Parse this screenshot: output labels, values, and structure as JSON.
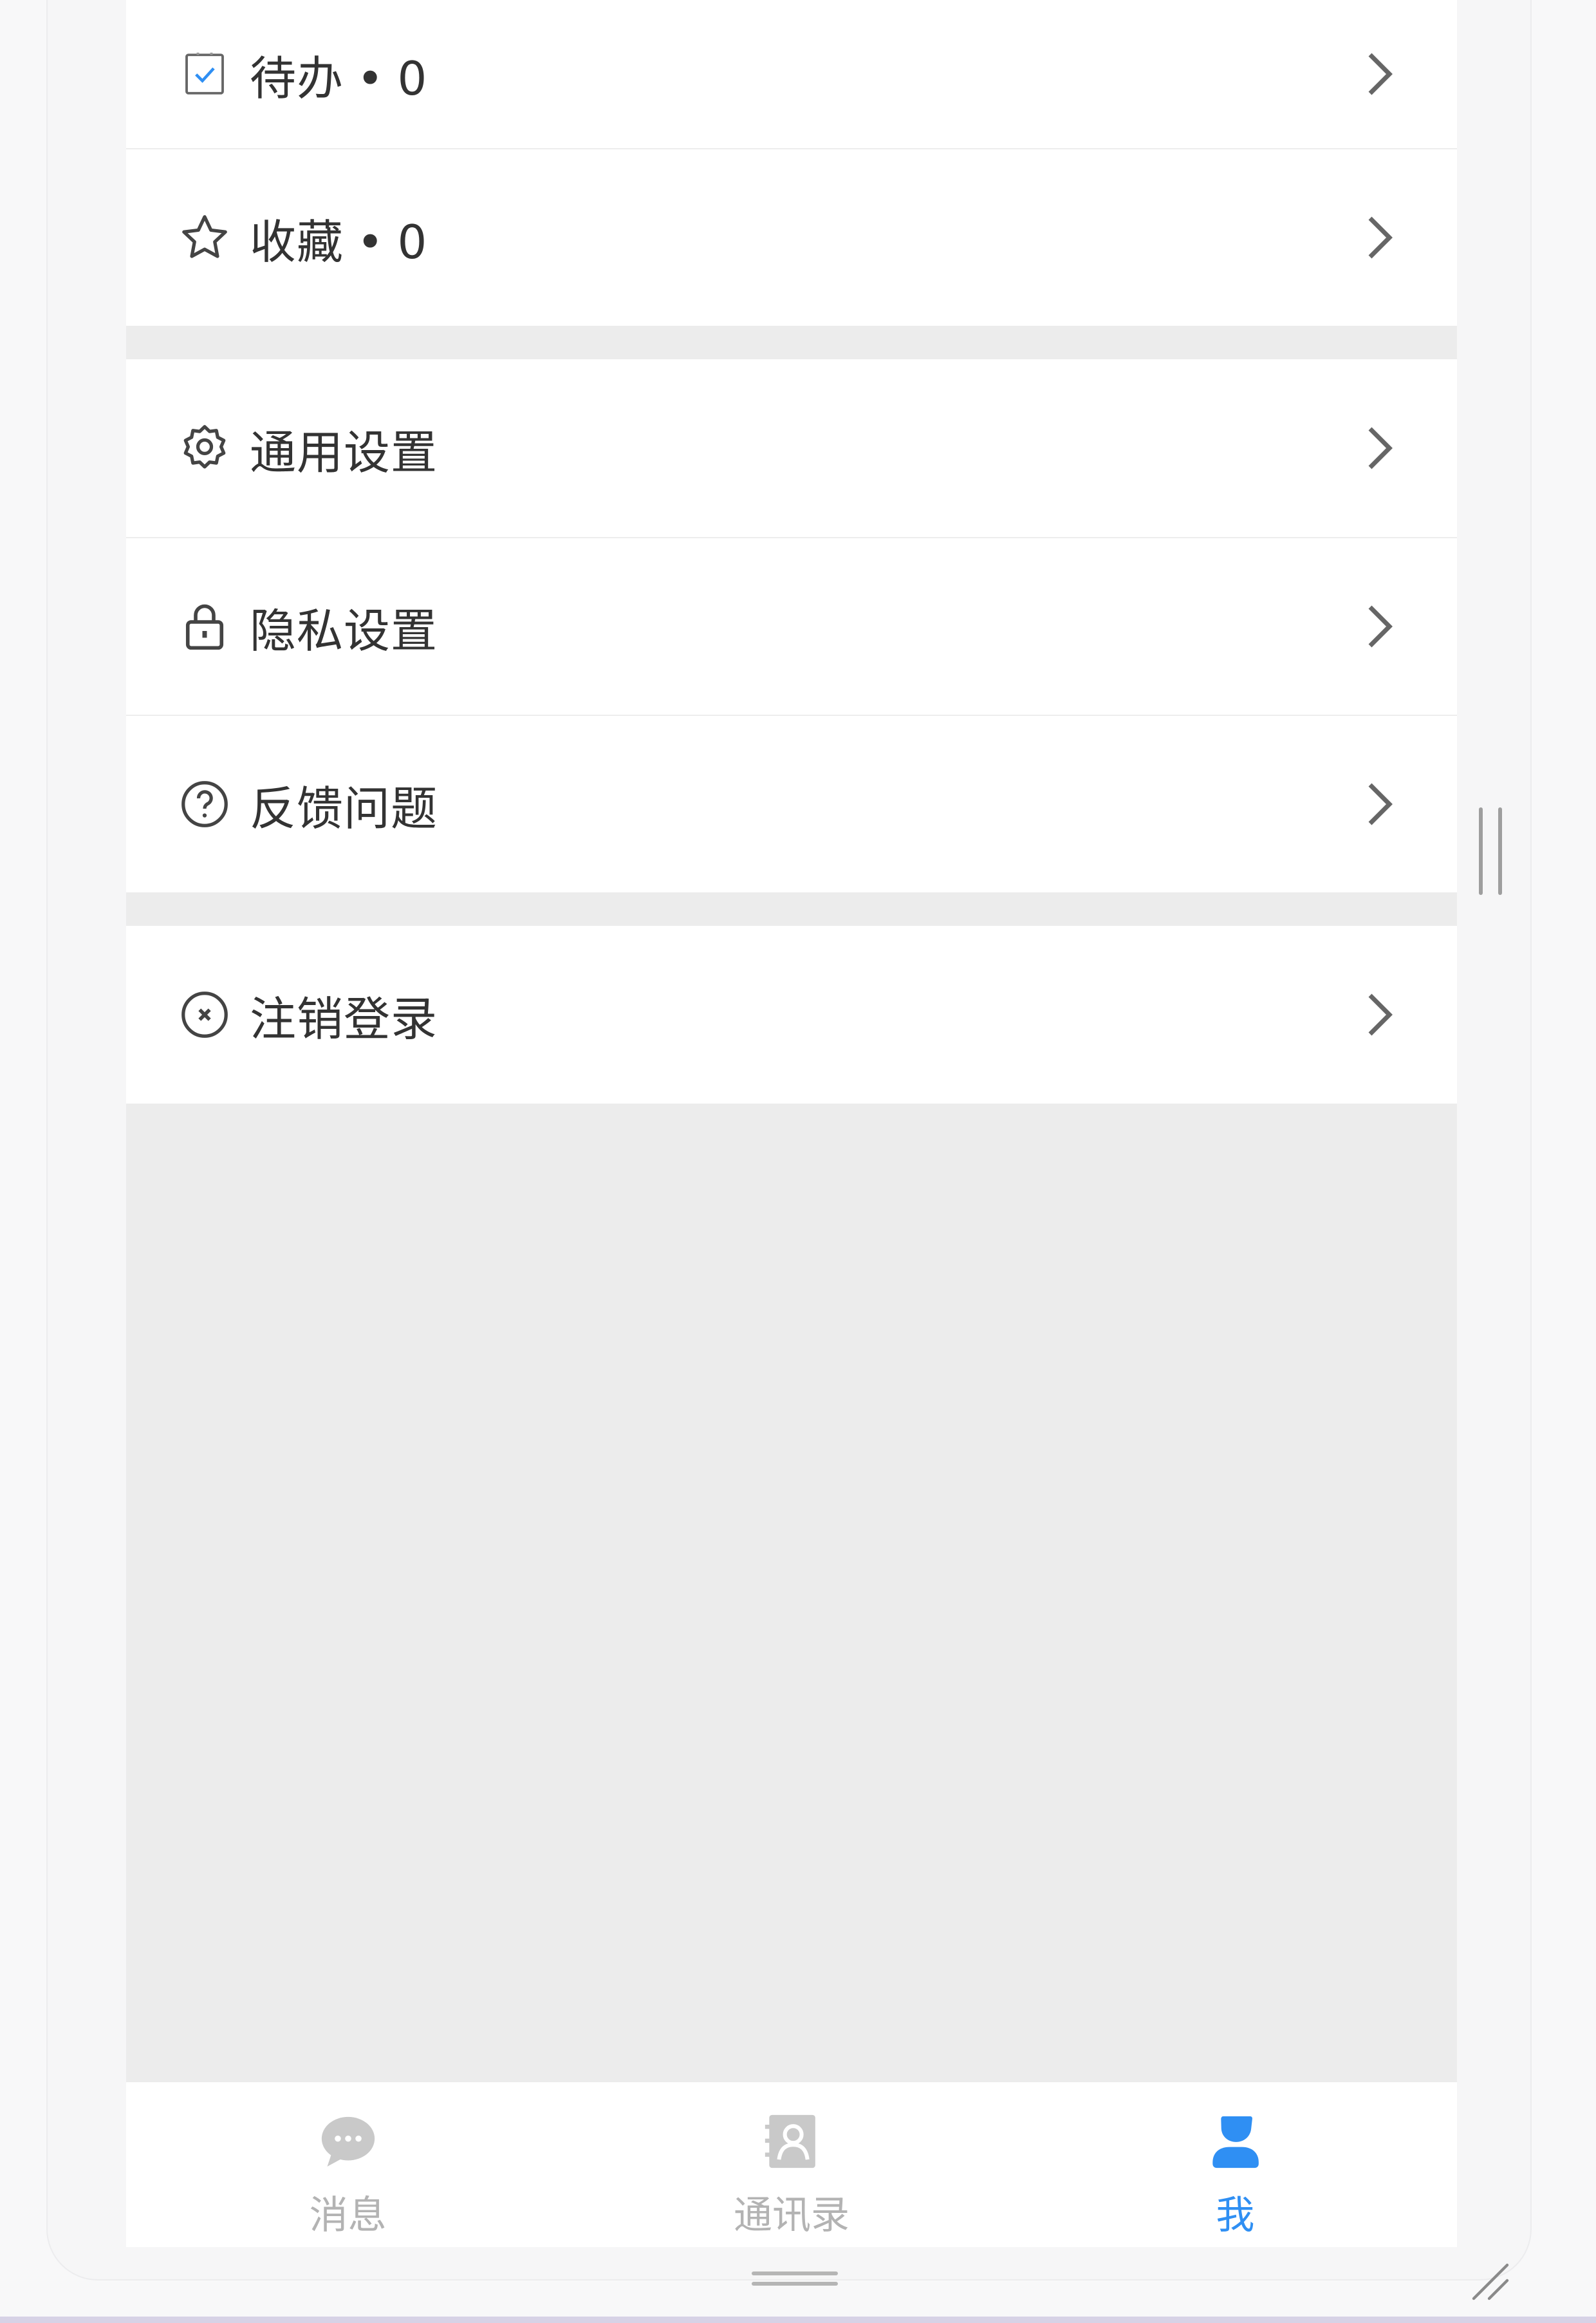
{
  "menu": {
    "groups": [
      {
        "items": [
          {
            "icon": "todo-checkbox-icon",
            "label": "待办",
            "sep": "•",
            "count": "0"
          },
          {
            "icon": "star-icon",
            "label": "收藏",
            "sep": "•",
            "count": "0"
          }
        ]
      },
      {
        "items": [
          {
            "icon": "gear-icon",
            "label": "通用设置"
          },
          {
            "icon": "lock-icon",
            "label": "隐私设置"
          },
          {
            "icon": "question-circle-icon",
            "label": "反馈问题"
          }
        ]
      },
      {
        "items": [
          {
            "icon": "close-circle-icon",
            "label": "注销登录"
          }
        ]
      }
    ]
  },
  "tabbar": {
    "tabs": [
      {
        "icon": "chat-bubble-icon",
        "label": "消息",
        "active": false
      },
      {
        "icon": "contacts-book-icon",
        "label": "通讯录",
        "active": false
      },
      {
        "icon": "person-icon",
        "label": "我",
        "active": true
      }
    ]
  },
  "colors": {
    "accent": "#2f8ff3",
    "inactive_tab": "#b3b3b3",
    "text": "#333333",
    "background": "#ececec"
  }
}
